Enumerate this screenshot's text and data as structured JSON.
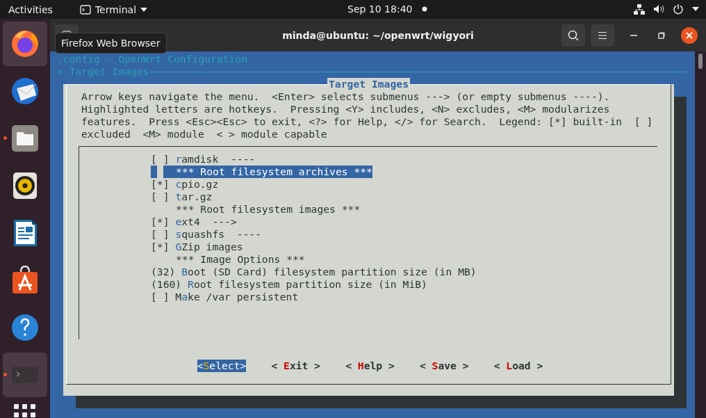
{
  "top_bar": {
    "activities": "Activities",
    "app_menu": "Terminal",
    "clock": "Sep 10  18:40"
  },
  "dock": {
    "items": [
      {
        "kind": "fox",
        "highlighted": true,
        "running": false
      },
      {
        "kind": "bird",
        "highlighted": false,
        "running": false
      },
      {
        "kind": "folder",
        "highlighted": false,
        "running": true
      },
      {
        "kind": "speaker",
        "highlighted": false,
        "running": false
      },
      {
        "kind": "document",
        "highlighted": false,
        "running": false
      },
      {
        "kind": "bag",
        "highlighted": false,
        "running": false
      },
      {
        "kind": "help",
        "highlighted": false,
        "running": false
      },
      {
        "kind": "terminal",
        "highlighted": true,
        "running": true
      }
    ]
  },
  "tooltip": {
    "text": "Firefox Web Browser"
  },
  "window": {
    "title": "minda@ubuntu: ~/openwrt/wigyori"
  },
  "terminal": {
    "header": ".config - OpenWrt Configuration",
    "breadcrumb": "> Target Images",
    "dialog": {
      "title": "Target Images",
      "help_lines": [
        "Arrow keys navigate the menu.  <Enter> selects submenus ---> (or empty submenus ----).",
        "Highlighted letters are hotkeys.  Pressing <Y> includes, <N> excludes, <M> modularizes",
        "features.  Press <Esc><Esc> to exit, <?> for Help, </> for Search.  Legend: [*] built-in  [ ]",
        "excluded  <M> module  < > module capable"
      ],
      "items": [
        {
          "kind": "option",
          "prefix": "[ ]",
          "hotkey": "r",
          "rest": "amdisk  ----",
          "selected": false
        },
        {
          "kind": "comment",
          "label": "*** Root filesystem archives ***",
          "selected": true
        },
        {
          "kind": "option",
          "prefix": "[*]",
          "hotkey": "c",
          "rest": "pio.gz",
          "selected": false
        },
        {
          "kind": "option",
          "prefix": "[ ]",
          "hotkey": "t",
          "rest": "ar.gz",
          "selected": false
        },
        {
          "kind": "comment",
          "label": "*** Root filesystem images ***",
          "selected": false
        },
        {
          "kind": "option",
          "prefix": "[*]",
          "hotkey": "e",
          "rest": "xt4  --->",
          "selected": false
        },
        {
          "kind": "option",
          "prefix": "[ ]",
          "hotkey": "s",
          "rest": "quashfs  ----",
          "selected": false
        },
        {
          "kind": "option",
          "prefix": "[*]",
          "hotkey": "G",
          "rest": "Zip images",
          "selected": false
        },
        {
          "kind": "comment",
          "label": "*** Image Options ***",
          "selected": false
        },
        {
          "kind": "option",
          "prefix": "(32)",
          "hotkey": "B",
          "rest": "oot (SD Card) filesystem partition size (in MB)",
          "selected": false
        },
        {
          "kind": "option",
          "prefix": "(160)",
          "hotkey": "R",
          "rest": "oot filesystem partition size (in MiB)",
          "selected": false
        },
        {
          "kind": "option",
          "prefix": "[ ]",
          "lead": "M",
          "hotkey": "a",
          "rest": "ke /var persistent",
          "selected": false
        }
      ],
      "buttons": [
        {
          "open": "<",
          "hotkey": "S",
          "rest": "elect>",
          "selected": true
        },
        {
          "open": "< ",
          "hotkey": "E",
          "rest": "xit >",
          "selected": false
        },
        {
          "open": "< ",
          "hotkey": "H",
          "rest": "elp >",
          "selected": false
        },
        {
          "open": "< ",
          "hotkey": "S",
          "rest": "ave >",
          "selected": false
        },
        {
          "open": "< ",
          "hotkey": "L",
          "rest": "oad >",
          "selected": false
        }
      ]
    }
  }
}
